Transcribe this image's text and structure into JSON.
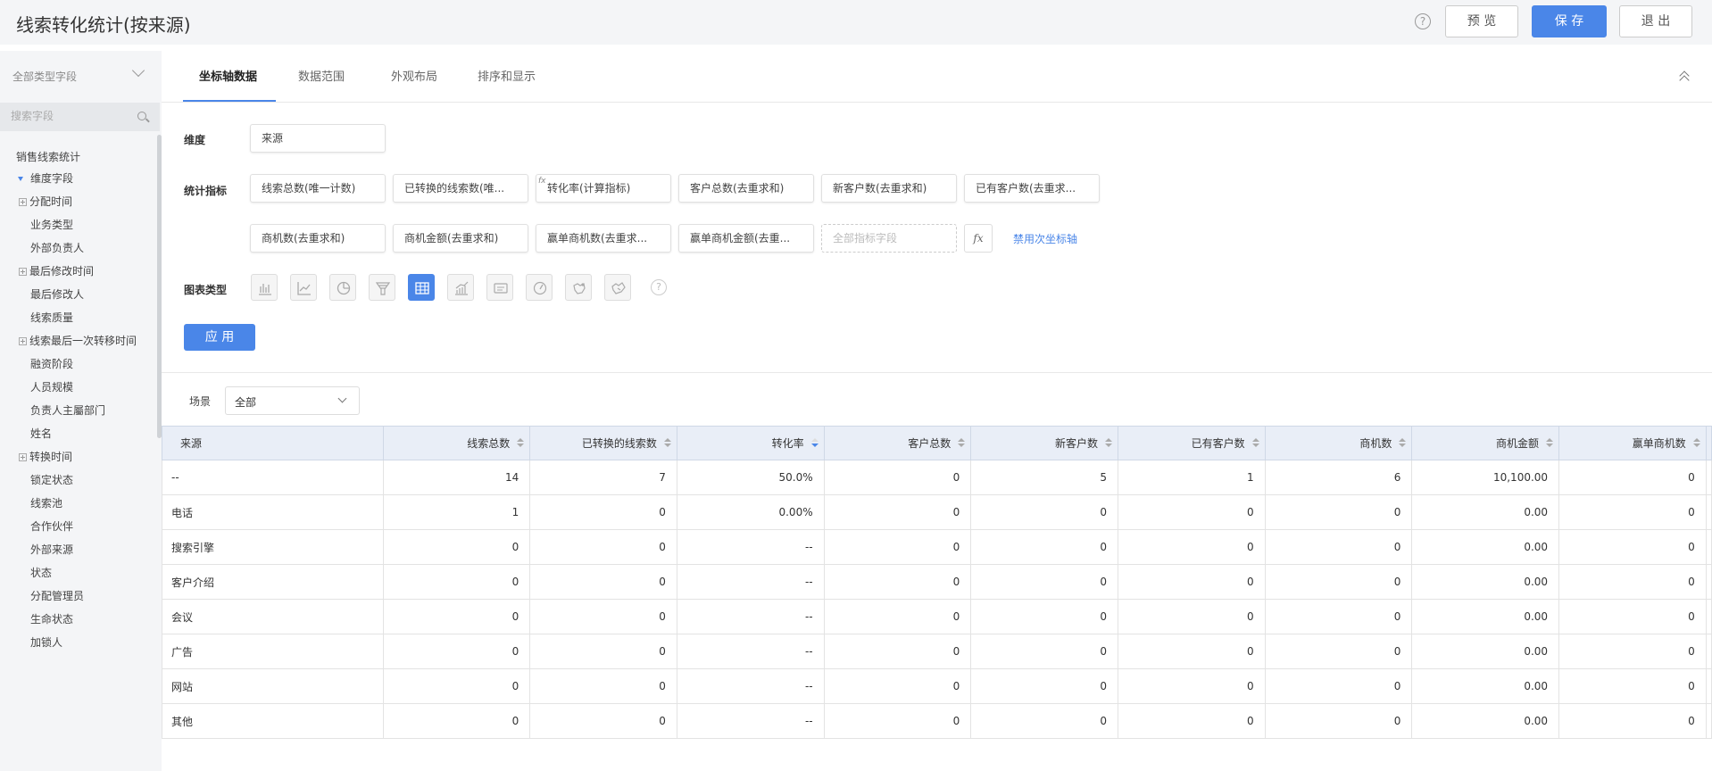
{
  "header": {
    "title": "线索转化统计(按来源)",
    "help": "?",
    "preview_label": "预 览",
    "save_label": "保 存",
    "exit_label": "退 出"
  },
  "sidebar": {
    "type_select": "全部类型字段",
    "search_placeholder": "搜索字段",
    "items": [
      {
        "label": "销售线索统计"
      },
      {
        "label": "维度字段"
      },
      {
        "label": "分配时间"
      },
      {
        "label": "业务类型"
      },
      {
        "label": "外部负责人"
      },
      {
        "label": "最后修改时间"
      },
      {
        "label": "最后修改人"
      },
      {
        "label": "线索质量"
      },
      {
        "label": "线索最后一次转移时间"
      },
      {
        "label": "融资阶段"
      },
      {
        "label": "人员规模"
      },
      {
        "label": "负责人主屬部门"
      },
      {
        "label": "姓名"
      },
      {
        "label": "转换时间"
      },
      {
        "label": "锁定状态"
      },
      {
        "label": "线索池"
      },
      {
        "label": "合作伙伴"
      },
      {
        "label": "外部来源"
      },
      {
        "label": "状态"
      },
      {
        "label": "分配管理员"
      },
      {
        "label": "生命状态"
      },
      {
        "label": "加锁人"
      }
    ]
  },
  "tabs": [
    {
      "label": "坐标轴数据"
    },
    {
      "label": "数据范围"
    },
    {
      "label": "外观布局"
    },
    {
      "label": "排序和显示"
    }
  ],
  "config": {
    "dimension_label": "维度",
    "dimension_value": "来源",
    "metrics_label": "统计指标",
    "metrics": [
      "线索总数(唯一计数)",
      "已转换的线索数(唯...",
      "转化率(计算指标)",
      "客户总数(去重求和)",
      "新客户数(去重求和)",
      "已有客户数(去重求...",
      "商机数(去重求和)",
      "商机金额(去重求和)",
      "赢单商机数(去重求...",
      "赢单商机金额(去重..."
    ],
    "fx_badge": "fx",
    "metric_placeholder": "全部指标字段",
    "fx_button": "fx",
    "secondary_axis_link": "禁用次坐标轴",
    "chart_type_label": "图表类型",
    "chart_help": "?",
    "apply_label": "应 用"
  },
  "scene": {
    "label": "场景",
    "value": "全部"
  },
  "table": {
    "columns": [
      "来源",
      "线索总数",
      "已转换的线索数",
      "转化率",
      "客户总数",
      "新客户数",
      "已有客户数",
      "商机数",
      "商机金额",
      "赢单商机数"
    ],
    "rows": [
      [
        "--",
        "14",
        "7",
        "50.0%",
        "0",
        "5",
        "1",
        "6",
        "10,100.00",
        "0"
      ],
      [
        "电话",
        "1",
        "0",
        "0.00%",
        "0",
        "0",
        "0",
        "0",
        "0.00",
        "0"
      ],
      [
        "搜索引擎",
        "0",
        "0",
        "--",
        "0",
        "0",
        "0",
        "0",
        "0.00",
        "0"
      ],
      [
        "客户介绍",
        "0",
        "0",
        "--",
        "0",
        "0",
        "0",
        "0",
        "0.00",
        "0"
      ],
      [
        "会议",
        "0",
        "0",
        "--",
        "0",
        "0",
        "0",
        "0",
        "0.00",
        "0"
      ],
      [
        "广告",
        "0",
        "0",
        "--",
        "0",
        "0",
        "0",
        "0",
        "0.00",
        "0"
      ],
      [
        "网站",
        "0",
        "0",
        "--",
        "0",
        "0",
        "0",
        "0",
        "0.00",
        "0"
      ],
      [
        "其他",
        "0",
        "0",
        "--",
        "0",
        "0",
        "0",
        "0",
        "0.00",
        "0"
      ]
    ]
  },
  "colors": {
    "accent": "#4a86e8",
    "header_bg": "#f4f5f7",
    "table_header_bg": "#e9eef7"
  }
}
